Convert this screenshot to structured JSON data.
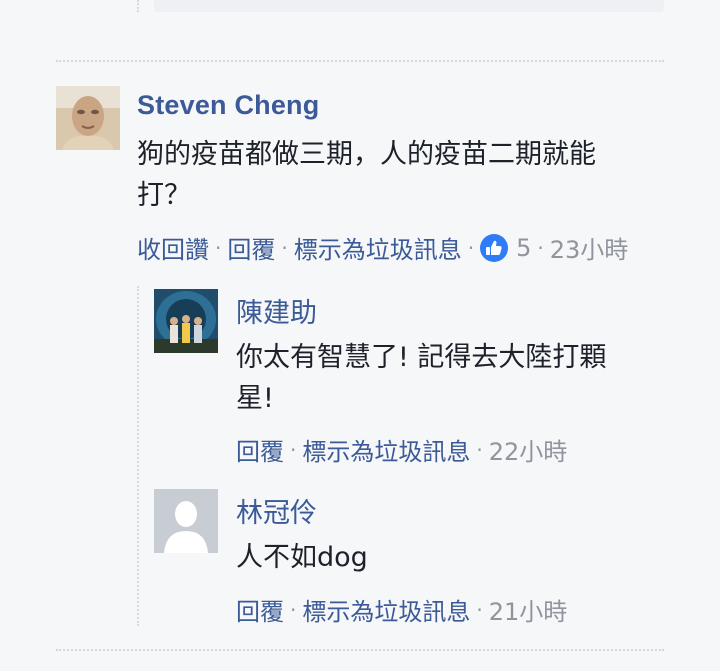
{
  "comments": {
    "main": {
      "author": "Steven Cheng",
      "text_line1": "狗的疫苗都做三期，人的疫苗二期就能",
      "text_line2": "打？",
      "actions": {
        "unlike_label": "收回讚",
        "reply_label": "回覆",
        "report_label": "標示為垃圾訊息",
        "like_count": "5",
        "time": "23小時",
        "dot": "·"
      },
      "accent_color": "#2f7cf6"
    },
    "reply1": {
      "author": "陳建助",
      "text_line1": "你太有智慧了! 記得去大陸打顆",
      "text_line2": "星!",
      "actions": {
        "reply_label": "回覆",
        "report_label": "標示為垃圾訊息",
        "time": "22小時",
        "dot": "·"
      }
    },
    "reply2": {
      "author": "林冠伶",
      "text": "人不如dog",
      "actions": {
        "reply_label": "回覆",
        "report_label": "標示為垃圾訊息",
        "time": "21小時",
        "dot": "·"
      }
    }
  },
  "colors": {
    "link": "#3b5a97",
    "text": "#1d2129",
    "meta": "#90949c",
    "background": "#f6f7f9"
  },
  "icons": {
    "like": "thumbs-up-icon",
    "default_avatar": "default-avatar-icon"
  }
}
